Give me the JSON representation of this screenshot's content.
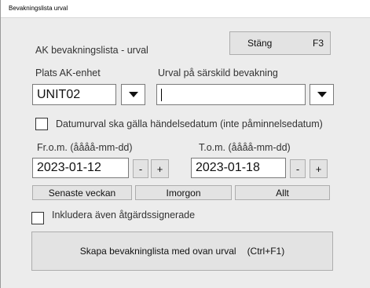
{
  "window": {
    "title": "Bevakningslista urval"
  },
  "header": {
    "form_title": "AK bevakningslista - urval"
  },
  "close_button": {
    "label": "Stäng",
    "shortcut": "F3"
  },
  "plats": {
    "label": "Plats AK-enhet",
    "value": "UNIT02"
  },
  "urval": {
    "label": "Urval på särskild bevakning",
    "value": ""
  },
  "date_event_checkbox": {
    "label": "Datumurval ska gälla händelsedatum (inte påminnelsedatum)",
    "checked": false
  },
  "from": {
    "label": "Fr.o.m. (åååå-mm-dd)",
    "value": "2023-01-12",
    "minus": "-",
    "plus": "+"
  },
  "tom": {
    "label": "T.o.m. (åååå-mm-dd)",
    "value": "2023-01-18",
    "minus": "-",
    "plus": "+"
  },
  "quick": {
    "last_week": "Senaste veckan",
    "tomorrow": "Imorgon",
    "all": "Allt"
  },
  "include_checkbox": {
    "label": "Inkludera även åtgärdssignerade",
    "checked": false
  },
  "create_button": {
    "label": "Skapa bevakninglista med ovan urval",
    "shortcut": "(Ctrl+F1)"
  },
  "icons": {
    "dropdown": "triangle-down-icon"
  }
}
